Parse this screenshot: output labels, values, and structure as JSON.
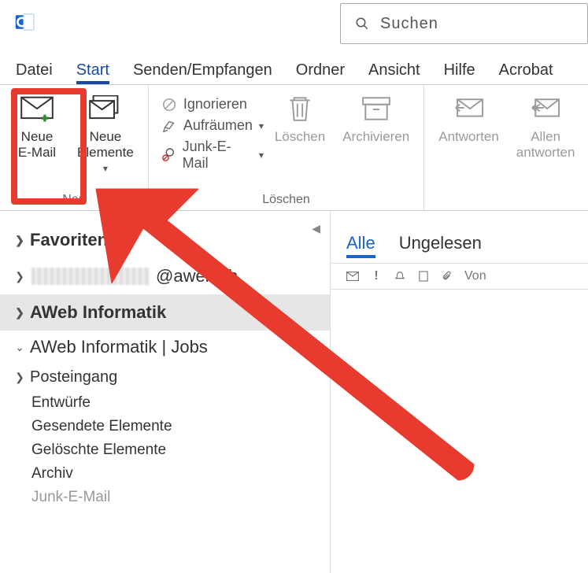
{
  "search": {
    "placeholder": "Suchen"
  },
  "tabs": [
    "Datei",
    "Start",
    "Senden/Empfangen",
    "Ordner",
    "Ansicht",
    "Hilfe",
    "Acrobat"
  ],
  "activeTab": 1,
  "ribbon": {
    "neu": {
      "label": "Neu",
      "newEmailL1": "Neue",
      "newEmailL2": "E-Mail",
      "newItemsL1": "Neue",
      "newItemsL2": "Elemente"
    },
    "loeschen": {
      "label": "Löschen",
      "ignore": "Ignorieren",
      "cleanup": "Aufräumen",
      "junk": "Junk-E-Mail",
      "delete": "Löschen",
      "archive": "Archivieren"
    },
    "reply": {
      "reply": "Antworten",
      "replyAllL1": "Allen",
      "replyAllL2": "antworten"
    }
  },
  "sidebar": {
    "favorites": "Favoriten",
    "accountSuffix": "@aweb.ch",
    "accountBold": "AWeb Informatik",
    "treeHead": "AWeb Informatik | Jobs",
    "folders": [
      "Posteingang",
      "Entwürfe",
      "Gesendete Elemente",
      "Gelöschte Elemente",
      "Archiv",
      "Junk-E-Mail"
    ]
  },
  "list": {
    "filters": [
      "Alle",
      "Ungelesen"
    ],
    "vonHeader": "Von"
  }
}
